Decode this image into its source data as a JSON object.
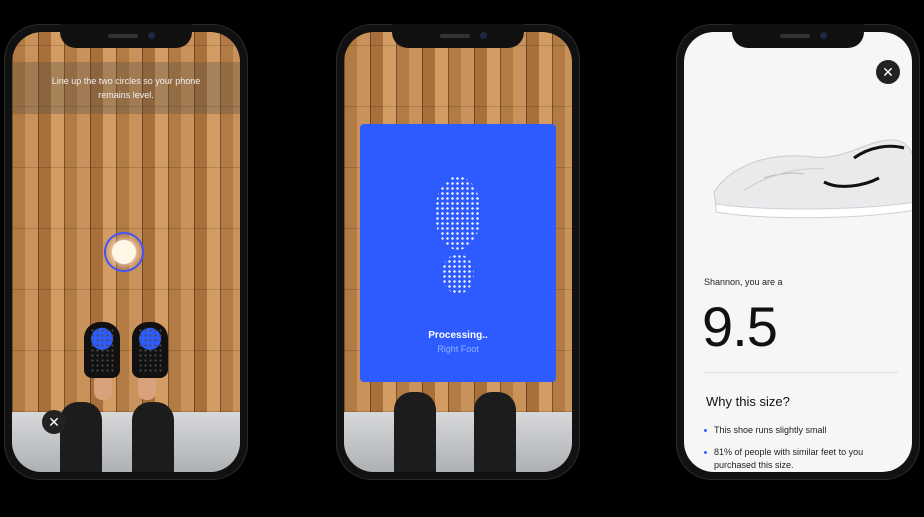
{
  "phone1": {
    "instruction": "Line up the two circles so your phone remains level.",
    "close_glyph": "✕"
  },
  "phone2": {
    "status_title": "Processing..",
    "status_sub": "Right Foot"
  },
  "phone3": {
    "close_glyph": "✕",
    "greeting": "Shannon, you are a",
    "size_value": "9.5",
    "why_title": "Why this size?",
    "bullets": [
      "This shoe runs slightly small",
      "81% of people with similar feet to you purchased this size."
    ]
  },
  "colors": {
    "accent_blue": "#2d5bff",
    "level_ring": "#3f4fff"
  }
}
